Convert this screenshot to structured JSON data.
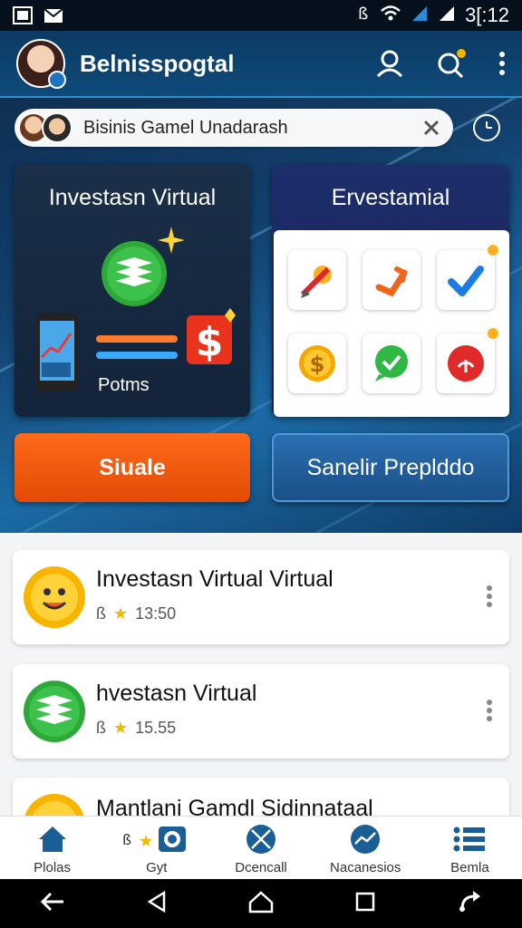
{
  "status_bar": {
    "time": "3[:12"
  },
  "app_bar": {
    "title": "Belnisspogtal"
  },
  "search": {
    "value": "Bisinis Gamel Unadarash"
  },
  "card_left": {
    "title": "Investasn Virtual",
    "points_label": "Potms"
  },
  "card_right": {
    "title": "Ervestamial",
    "tiles": [
      "pencil-tool-icon",
      "arrow-turn-icon",
      "checkmark-icon",
      "dollar-coin-icon",
      "chat-check-icon",
      "power-icon"
    ]
  },
  "buttons": {
    "primary": "Siuale",
    "secondary": "Sanelir Preplddo"
  },
  "list": [
    {
      "title": "Investasn Virtual Virtual",
      "meta": "13:50",
      "icon": "sun-face-icon"
    },
    {
      "title": "hvestasn Virtual",
      "meta": "15.55",
      "icon": "green-stack-icon"
    },
    {
      "title": "Mantlani Gamdl Sidinnataal",
      "meta": "",
      "icon": "sun-face-icon"
    }
  ],
  "bottom_nav": [
    {
      "label": "Plolas",
      "icon": "home-icon"
    },
    {
      "label": "Gyt",
      "icon": "gear-icon"
    },
    {
      "label": "Dcencall",
      "icon": "globe-x-icon"
    },
    {
      "label": "Nacanesios",
      "icon": "trend-globe-icon"
    },
    {
      "label": "Bemla",
      "icon": "list-icon"
    }
  ],
  "colors": {
    "accent_orange": "#e24a06",
    "accent_blue": "#1b4f88",
    "hero_bg": "#123f6b"
  }
}
